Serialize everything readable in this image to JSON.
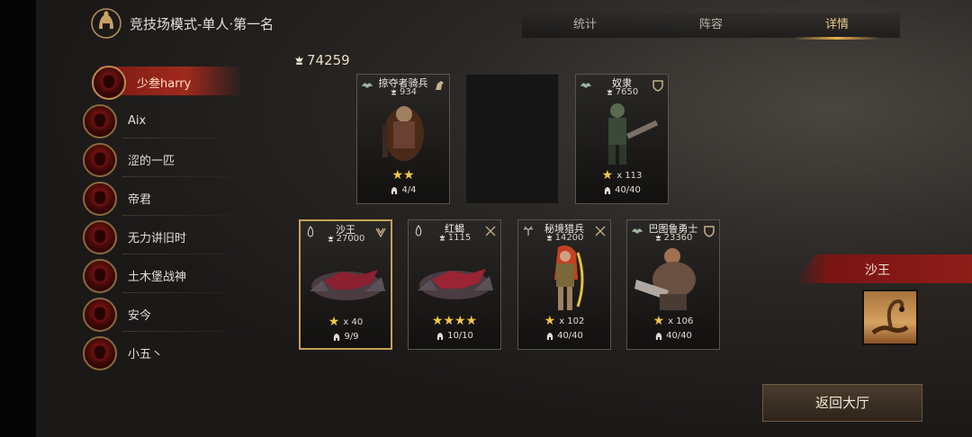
{
  "header": {
    "title": "竞技场模式-单人·第一名"
  },
  "tabs": [
    {
      "label": "统计",
      "active": false
    },
    {
      "label": "阵容",
      "active": false
    },
    {
      "label": "详情",
      "active": true
    }
  ],
  "players": [
    {
      "name": "少叁harry",
      "active": true
    },
    {
      "name": "Aix"
    },
    {
      "name": "涩的一匹"
    },
    {
      "name": "帝君"
    },
    {
      "name": "无力讲旧时"
    },
    {
      "name": "土木堡战神"
    },
    {
      "name": "安今"
    },
    {
      "name": "小五丶"
    }
  ],
  "team_power": "74259",
  "top_row": [
    {
      "name": "掠夺者骑兵",
      "power": "934",
      "stars": "★★",
      "star_mult": "",
      "capacity": "4/4"
    },
    {
      "empty": true
    },
    {
      "name": "奴隶",
      "power": "7650",
      "stars": "★",
      "star_mult": "x 113",
      "capacity": "40/40"
    }
  ],
  "bottom_row": [
    {
      "name": "沙王",
      "power": "27000",
      "stars": "★",
      "star_mult": "x 40",
      "capacity": "9/9",
      "selected": true
    },
    {
      "name": "红蝎",
      "power": "1115",
      "stars": "★★★★",
      "star_mult": "",
      "capacity": "10/10"
    },
    {
      "name": "秘境猎兵",
      "power": "14200",
      "stars": "★",
      "star_mult": "x 102",
      "capacity": "40/40"
    },
    {
      "name": "巴图鲁勇士",
      "power": "23360",
      "stars": "★",
      "star_mult": "x 106",
      "capacity": "40/40"
    }
  ],
  "selected_hero": {
    "name": "沙王"
  },
  "back_button": {
    "label": "返回大厅"
  },
  "colors": {
    "accent_gold": "#e8c886",
    "banner_red": "#8e1c19",
    "star": "#f6c844"
  }
}
